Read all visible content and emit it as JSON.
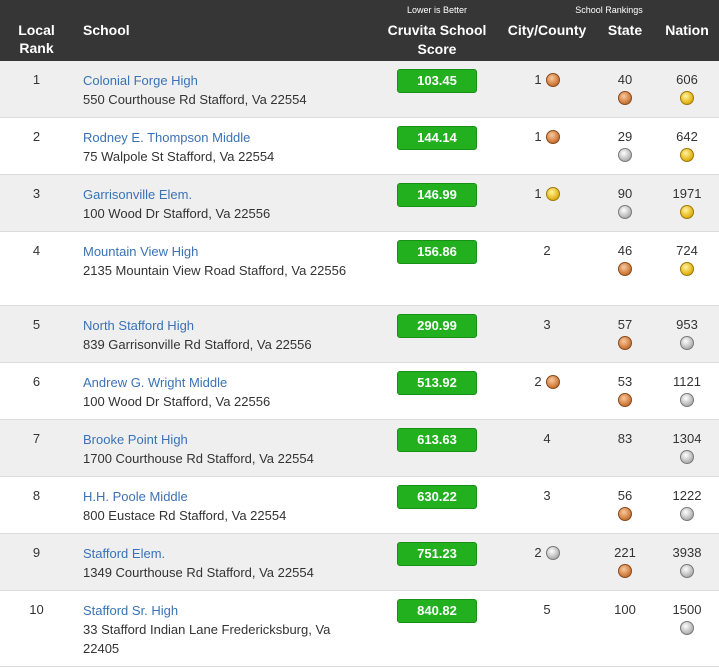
{
  "header": {
    "local_rank": "Local Rank",
    "school": "School",
    "lower_better": "Lower is Better",
    "score": "Cruvita School Score",
    "rankings_group": "School Rankings",
    "city": "City/County",
    "state": "State",
    "nation": "Nation"
  },
  "medal_colors": {
    "gold": "#e6b91e",
    "silver": "#bcbcbc",
    "bronze": "#d27f3e"
  },
  "score_color": "#22b01f",
  "rows": [
    {
      "rank": "1",
      "name": "Colonial Forge High",
      "address": "550 Courthouse Rd Stafford, Va 22554",
      "score": "103.45",
      "city": "1",
      "city_medal": "bronze",
      "state": "40",
      "state_medal": "bronze",
      "nation": "606",
      "nation_medal": "gold"
    },
    {
      "rank": "2",
      "name": "Rodney E. Thompson Middle",
      "address": "75 Walpole St Stafford, Va 22554",
      "score": "144.14",
      "city": "1",
      "city_medal": "bronze",
      "state": "29",
      "state_medal": "silver",
      "nation": "642",
      "nation_medal": "gold"
    },
    {
      "rank": "3",
      "name": "Garrisonville Elem.",
      "address": "100 Wood Dr Stafford, Va 22556",
      "score": "146.99",
      "city": "1",
      "city_medal": "gold",
      "state": "90",
      "state_medal": "silver",
      "nation": "1971",
      "nation_medal": "gold"
    },
    {
      "rank": "4",
      "name": "Mountain View High",
      "address": "2135 Mountain View Road Stafford, Va 22556",
      "score": "156.86",
      "city": "2",
      "city_medal": "",
      "state": "46",
      "state_medal": "bronze",
      "nation": "724",
      "nation_medal": "gold"
    },
    {
      "rank": "5",
      "name": "North Stafford High",
      "address": "839 Garrisonville Rd Stafford, Va 22556",
      "score": "290.99",
      "city": "3",
      "city_medal": "",
      "state": "57",
      "state_medal": "bronze",
      "nation": "953",
      "nation_medal": "silver"
    },
    {
      "rank": "6",
      "name": "Andrew G. Wright Middle",
      "address": "100 Wood Dr Stafford, Va 22556",
      "score": "513.92",
      "city": "2",
      "city_medal": "bronze",
      "state": "53",
      "state_medal": "bronze",
      "nation": "1121",
      "nation_medal": "silver"
    },
    {
      "rank": "7",
      "name": "Brooke Point High",
      "address": "1700 Courthouse Rd Stafford, Va 22554",
      "score": "613.63",
      "city": "4",
      "city_medal": "",
      "state": "83",
      "state_medal": "",
      "nation": "1304",
      "nation_medal": "silver"
    },
    {
      "rank": "8",
      "name": "H.H. Poole Middle",
      "address": "800 Eustace Rd Stafford, Va 22554",
      "score": "630.22",
      "city": "3",
      "city_medal": "",
      "state": "56",
      "state_medal": "bronze",
      "nation": "1222",
      "nation_medal": "silver"
    },
    {
      "rank": "9",
      "name": "Stafford Elem.",
      "address": "1349 Courthouse Rd Stafford, Va 22554",
      "score": "751.23",
      "city": "2",
      "city_medal": "silver",
      "state": "221",
      "state_medal": "bronze",
      "nation": "3938",
      "nation_medal": "silver"
    },
    {
      "rank": "10",
      "name": "Stafford Sr. High",
      "address": "33 Stafford Indian Lane Fredericksburg, Va 22405",
      "score": "840.82",
      "city": "5",
      "city_medal": "",
      "state": "100",
      "state_medal": "",
      "nation": "1500",
      "nation_medal": "silver"
    }
  ]
}
